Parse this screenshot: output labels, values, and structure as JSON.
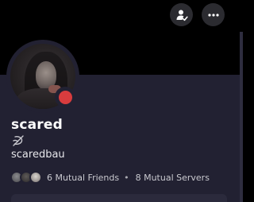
{
  "profile": {
    "display_name": "scared",
    "username": "scaredbau",
    "status": "do-not-disturb",
    "status_color": "#d83c3e",
    "name_badge_icon": "nitro-slash-icon"
  },
  "mutuals": {
    "friends": "6 Mutual Friends",
    "servers": "8 Mutual Servers",
    "separator": "•"
  },
  "actions": {
    "add_friend_icon": "add-friend-icon",
    "more_icon": "more-icon"
  },
  "colors": {
    "banner": "#000000",
    "panel": "#222132"
  }
}
